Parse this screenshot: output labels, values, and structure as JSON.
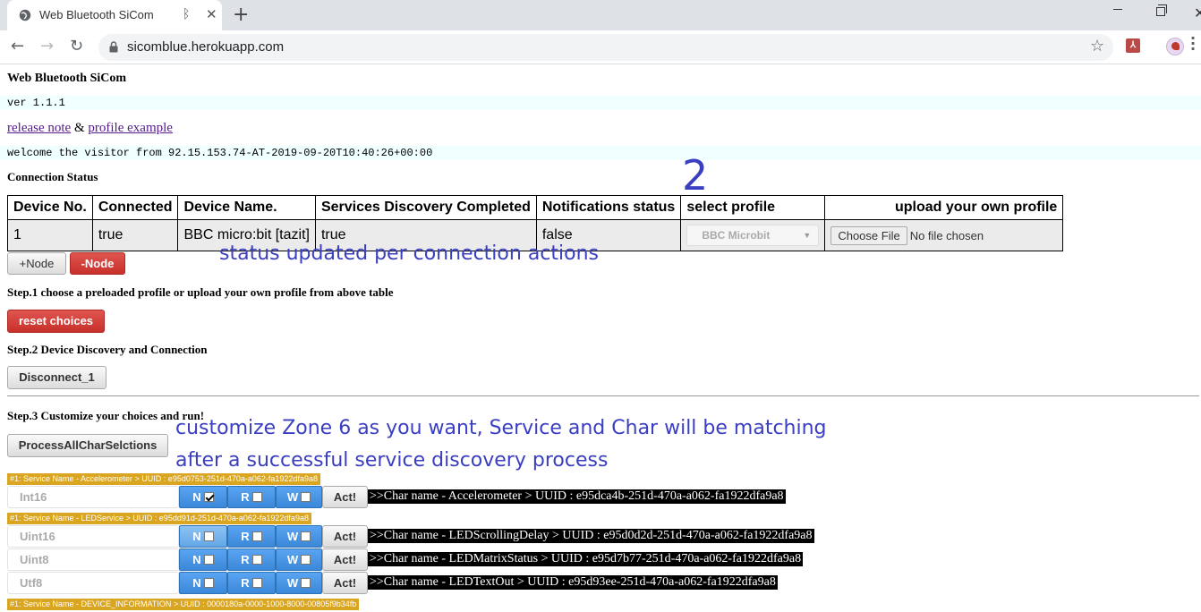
{
  "browser": {
    "tab_title": "Web Bluetooth SiCom",
    "url": "sicomblue.herokuapp.com"
  },
  "page": {
    "title": "Web Bluetooth SiCom",
    "version": "ver 1.1.1",
    "release_note": "release note",
    "amp": "&",
    "profile_example": "profile example",
    "welcome": "welcome the visitor from 92.15.153.74-AT-2019-09-20T10:40:26+00:00",
    "connection_status": "Connection Status"
  },
  "status_table": {
    "headers": [
      "Device No.",
      "Connected",
      "Device Name.",
      "Services Discovery Completed",
      "Notifications status",
      "select profile",
      "upload your own profile"
    ],
    "row": {
      "device_no": "1",
      "connected": "true",
      "device_name": "BBC micro:bit [tazit]",
      "discovery": "true",
      "notifications": "false",
      "profile": "BBC Microbit",
      "file_button": "Choose File",
      "file_text": "No file chosen"
    }
  },
  "buttons": {
    "add_node": "+Node",
    "remove_node": "-Node",
    "reset": "reset choices",
    "disconnect": "Disconnect_1",
    "process_all": "ProcessAllCharSelctions"
  },
  "steps": {
    "step1": "Step.1 choose a preloaded profile or upload your own profile from above table",
    "step2": "Step.2 Device Discovery and Connection",
    "step3": "Step.3 Customize your choices and run!"
  },
  "services": [
    {
      "label": "#1: Service Name - Accelerometer > UUID : e95d0753-251d-470a-a062-fa1922dfa9a8",
      "chars": [
        {
          "type": "Int16",
          "n": "N",
          "r": "R",
          "w": "W",
          "n_checked": true,
          "act": "Act!",
          "name": ">>Char name - Accelerometer > UUID : e95dca4b-251d-470a-a062-fa1922dfa9a8"
        }
      ]
    },
    {
      "label": "#1: Service Name - LEDService > UUID : e95dd91d-251d-470a-a062-fa1922dfa9a8",
      "chars": [
        {
          "type": "Uint16",
          "n": "N",
          "r": "R",
          "w": "W",
          "n_checked": false,
          "act": "Act!",
          "name": ">>Char name - LEDScrollingDelay > UUID : e95d0d2d-251d-470a-a062-fa1922dfa9a8"
        },
        {
          "type": "Uint8",
          "n": "N",
          "r": "R",
          "w": "W",
          "n_checked": false,
          "act": "Act!",
          "name": ">>Char name - LEDMatrixStatus > UUID : e95d7b77-251d-470a-a062-fa1922dfa9a8"
        },
        {
          "type": "Utf8",
          "n": "N",
          "r": "R",
          "w": "W",
          "n_checked": false,
          "act": "Act!",
          "name": ">>Char name - LEDTextOut > UUID : e95d93ee-251d-470a-a062-fa1922dfa9a8"
        }
      ]
    },
    {
      "label": "#1: Service Name - DEVICE_INFORMATION > UUID : 0000180a-0000-1000-8000-00805f9b34fb",
      "chars": []
    }
  ],
  "annotations": {
    "number": "2",
    "status_note": "status updated per connection actions",
    "customize_line1": "customize Zone 6 as you want, Service and Char will be matching",
    "customize_line2": "after a successful service discovery process"
  }
}
